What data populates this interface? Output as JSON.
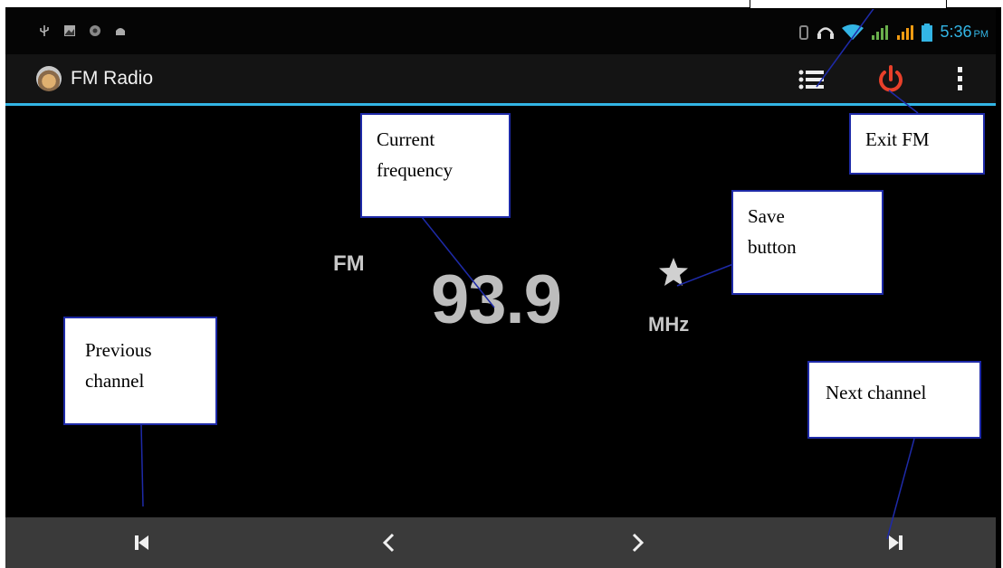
{
  "status_bar": {
    "time": "5:36",
    "ampm": "PM",
    "left_icons": [
      "usb-icon",
      "image-icon",
      "circle-app-icon",
      "android-icon"
    ],
    "right_icons": [
      "vibrate-icon",
      "headset-icon",
      "wifi-icon",
      "signal-icon",
      "signal-icon",
      "battery-icon"
    ]
  },
  "action_bar": {
    "title": "FM Radio",
    "buttons": [
      "channel-list-icon",
      "power-icon",
      "overflow-menu-icon"
    ]
  },
  "tuner": {
    "band": "FM",
    "frequency": "93.9",
    "unit": "MHz"
  },
  "controls": [
    "previous-channel-icon",
    "seek-back-icon",
    "seek-forward-icon",
    "next-channel-icon"
  ],
  "annotations": {
    "current_frequency": "Current frequency",
    "exit_fm": "Exit FM",
    "save_button": "Save button",
    "previous_channel": "Previous channel",
    "next_channel": "Next channel"
  },
  "colors": {
    "accent": "#33b5e5",
    "power": "#e8402a",
    "callout_border": "#1e2aa8"
  }
}
